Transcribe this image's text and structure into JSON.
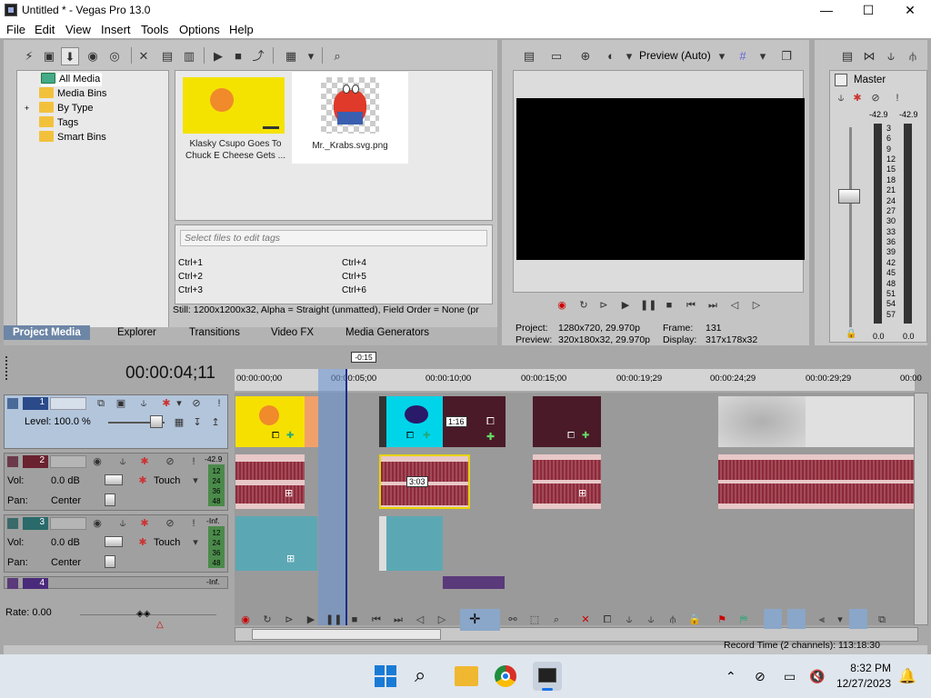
{
  "window": {
    "title": "Untitled * - Vegas Pro 13.0",
    "controls": {
      "minimize": "—",
      "maximize": "☐",
      "close": "✕"
    }
  },
  "menu": [
    "File",
    "Edit",
    "View",
    "Insert",
    "Tools",
    "Options",
    "Help"
  ],
  "media": {
    "tree": [
      {
        "label": "All Media",
        "selected": true
      },
      {
        "label": "Media Bins"
      },
      {
        "label": "By Type",
        "expander": "+"
      },
      {
        "label": "Tags"
      },
      {
        "label": "Smart Bins"
      }
    ],
    "thumbnails": [
      {
        "caption_line1": "Klasky Csupo Goes To",
        "caption_line2": "Chuck E Cheese Gets ..."
      },
      {
        "caption_line1": "Mr._Krabs.svg.png",
        "caption_line2": ""
      }
    ],
    "tag_placeholder": "Select files to edit tags",
    "shortcuts": [
      "Ctrl+1",
      "Ctrl+4",
      "Ctrl+2",
      "Ctrl+5",
      "Ctrl+3",
      "Ctrl+6"
    ],
    "status": "Still: 1200x1200x32, Alpha = Straight (unmatted), Field Order = None (pr",
    "tabs": [
      "Project Media",
      "Explorer",
      "Transitions",
      "Video FX",
      "Media Generators"
    ]
  },
  "preview": {
    "mode": "Preview (Auto)",
    "project_label": "Project:",
    "project_value": "1280x720, 29.970p",
    "preview_label": "Preview:",
    "preview_value": "320x180x32, 29.970p",
    "frame_label": "Frame:",
    "frame_value": "131",
    "display_label": "Display:",
    "display_value": "317x178x32"
  },
  "master": {
    "label": "Master",
    "peak_left": "-42.9",
    "peak_right": "-42.9",
    "scale": [
      "3",
      "6",
      "9",
      "12",
      "15",
      "18",
      "21",
      "24",
      "27",
      "30",
      "33",
      "36",
      "39",
      "42",
      "45",
      "48",
      "51",
      "54",
      "57"
    ],
    "bottom_left": "0.0",
    "bottom_right": "0.0"
  },
  "timeline": {
    "timecode": "00:00:04;11",
    "marker": "-0:15",
    "ruler": [
      "00:00:00;00",
      "00:00:05;00",
      "00:00:10;00",
      "00:00:15;00",
      "00:00:19;29",
      "00:00:24;29",
      "00:00:29;29",
      "00:00"
    ],
    "tracks": [
      {
        "num": "1",
        "type": "video",
        "level": "Level: 100.0 %"
      },
      {
        "num": "2",
        "type": "audio",
        "vol_label": "Vol:",
        "vol": "0.0 dB",
        "pan_label": "Pan:",
        "pan": "Center",
        "auto": "Touch",
        "peak": "-42.9",
        "scale": [
          "12",
          "24",
          "36",
          "48"
        ]
      },
      {
        "num": "3",
        "type": "audio",
        "vol_label": "Vol:",
        "vol": "0.0 dB",
        "pan_label": "Pan:",
        "pan": "Center",
        "auto": "Touch",
        "peak": "-Inf.",
        "scale": [
          "12",
          "24",
          "36",
          "48"
        ]
      },
      {
        "num": "4",
        "type": "audio",
        "peak": "-Inf."
      }
    ],
    "clip_labels": {
      "event_time": "1:16",
      "fade_time": "3:03"
    },
    "rate": "Rate: 0.00",
    "record_time": "Record Time (2 channels): 113:18:30"
  },
  "taskbar": {
    "time": "8:32 PM",
    "date": "12/27/2023"
  },
  "colors": {
    "accent_blue": "#6d86a6",
    "clip_yellow": "#f6e000",
    "clip_cyan": "#00d4e8",
    "audio_red": "#8c2a3a"
  }
}
